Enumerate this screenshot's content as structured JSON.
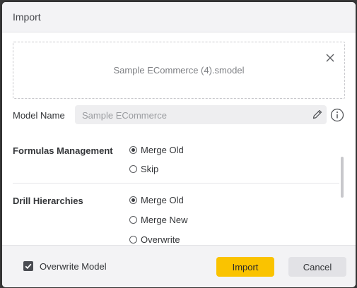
{
  "dialog": {
    "title": "Import",
    "file_name": "Sample ECommerce (4).smodel",
    "model_name_label": "Model Name",
    "model_name_value": "Sample ECommerce",
    "formulas": {
      "label": "Formulas Management",
      "options": [
        {
          "label": "Merge Old",
          "selected": true
        },
        {
          "label": "Skip",
          "selected": false
        }
      ]
    },
    "drill": {
      "label": "Drill Hierarchies",
      "options": [
        {
          "label": "Merge Old",
          "selected": true
        },
        {
          "label": "Merge New",
          "selected": false
        },
        {
          "label": "Overwrite",
          "selected": false
        }
      ]
    },
    "overwrite_model_label": "Overwrite Model",
    "overwrite_model_checked": true,
    "import_button": "Import",
    "cancel_button": "Cancel"
  },
  "colors": {
    "accent": "#fac300",
    "header_bg": "#f3f3f5"
  },
  "icons": [
    "close-icon",
    "pencil-icon",
    "info-icon",
    "check-icon"
  ]
}
